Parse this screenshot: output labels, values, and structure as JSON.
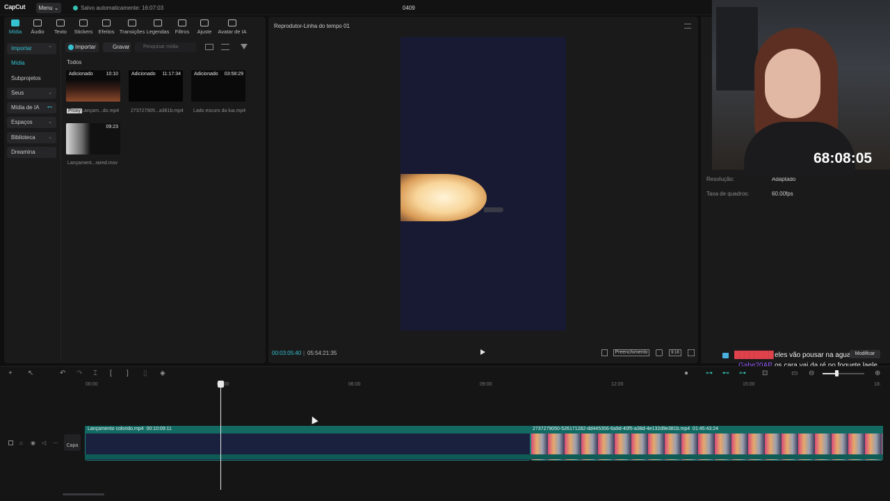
{
  "app": {
    "logo": "CapCut",
    "menu_label": "Menu ⌄",
    "save_status": "Salvo automaticamente: 16:07:03",
    "project_title": "0409"
  },
  "toolbar": {
    "tools": [
      "Mídia",
      "Áudio",
      "Texto",
      "Stickers",
      "Efeitos",
      "Transições",
      "Legendas",
      "Filtros",
      "Ajuste",
      "Avatar de IA"
    ],
    "active": "Mídia"
  },
  "sidebar": {
    "items": [
      {
        "label": "Importar",
        "chevron": "⌃"
      },
      {
        "label": "Mídia"
      },
      {
        "label": "Subprojetos"
      },
      {
        "label": "Seus",
        "chevron": "⌄"
      },
      {
        "label": "Mídia de IA",
        "chevron": "⊷"
      },
      {
        "label": "Espaços",
        "chevron": "⌄"
      },
      {
        "label": "Biblioteca",
        "chevron": "⌄"
      },
      {
        "label": "Dreamina"
      }
    ]
  },
  "media_panel": {
    "import_label": "Importar",
    "record_label": "Gravar",
    "search_placeholder": "Pesquisar mídia",
    "section": "Todos",
    "items": [
      {
        "tag": "Adicionado",
        "duration": "10:10",
        "name": "Lançam...do.mp4",
        "proxy": "Proxy"
      },
      {
        "tag": "Adicionado",
        "duration": "11:17:34",
        "name": "273727905...a381b.mp4"
      },
      {
        "tag": "Adicionado",
        "duration": "03:58:29",
        "name": "Lado escuro da lua.mp4"
      },
      {
        "tag": "",
        "duration": "09:23",
        "name": "Lançament...rared.mov"
      }
    ]
  },
  "player": {
    "title": "Reprodutor-Linha do tempo 01",
    "time_current": "00:03:05:40",
    "time_total": "05:54:21:35",
    "fill_label": "Preenchimento",
    "ratio_label": "9:16"
  },
  "properties": {
    "resolution_label": "Resolução:",
    "resolution_value": "Adaptado",
    "framerate_label": "Taxa de quadros:",
    "framerate_value": "60.00fps"
  },
  "stream_overlay": {
    "timer": "68:08:05",
    "chat": [
      {
        "user": "████████",
        "message": "eles vão pousar na agua ?",
        "color": "#e0424c"
      },
      {
        "user": "Gabe20AP",
        "message": "os cara vai da ré no foguete laele",
        "color": "#9a5cff"
      }
    ],
    "button": "Modificar"
  },
  "timeline": {
    "ticks": [
      "00:00",
      "03:00",
      "06:00",
      "09:00",
      "12:00",
      "15:00",
      "18:"
    ],
    "cover_label": "Capa",
    "clips": [
      {
        "name": "Lançamento colorido.mp4",
        "duration": "00:10:09:11"
      },
      {
        "name": "2737279050-526171282-dd445356-6a9d-40f5-a38d-4e132d9e381b.mp4",
        "duration": "01:45:43:24"
      }
    ]
  }
}
